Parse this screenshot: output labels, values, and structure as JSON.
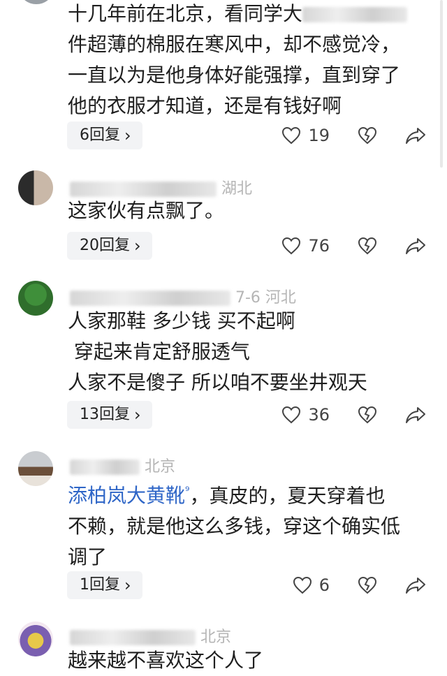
{
  "comments": [
    {
      "meta": "",
      "lines": [
        "十几年前在北京，看同学大",
        "件超薄的棉服在寒风中，却不感觉冷，",
        "一直以为是他身体好能强撑，直到穿了",
        "他的衣服才知道，还是有钱好啊"
      ],
      "replies": "6回复",
      "likes": "19"
    },
    {
      "meta": "湖北",
      "lines": [
        "这家伙有点飘了。"
      ],
      "replies": "20回复",
      "likes": "76"
    },
    {
      "meta": "7-6 河北",
      "lines": [
        "人家那鞋 多少钱 买不起啊",
        " 穿起来肯定舒服透气",
        "人家不是傻子 所以咱不要坐井观天"
      ],
      "replies": "13回复",
      "likes": "36"
    },
    {
      "meta": "北京",
      "mention": "添柏岚大黄靴",
      "mention_icon": "⁹",
      "lines": [
        "，真皮的，夏天穿着也",
        "不赖，就是他这么多钱，穿这个确实低",
        "调了"
      ],
      "replies": "1回复",
      "likes": "6"
    },
    {
      "meta": "北京",
      "lines": [
        "越来越不喜欢这个人了"
      ]
    }
  ],
  "reply_chevron": "›"
}
